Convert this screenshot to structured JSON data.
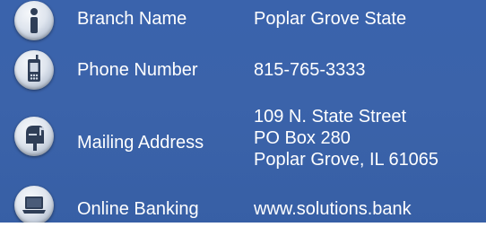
{
  "rows": {
    "branch": {
      "icon": "info-icon",
      "label": "Branch Name",
      "value": "Poplar Grove State"
    },
    "phone": {
      "icon": "phone-icon",
      "label": "Phone Number",
      "value": "815-765-3333"
    },
    "mailing": {
      "icon": "mailbox-icon",
      "label": "Mailing Address",
      "lines": [
        "109 N. State Street",
        "PO Box 280",
        "Poplar Grove, IL 61065"
      ]
    },
    "online": {
      "icon": "laptop-icon",
      "label": "Online Banking",
      "value": "www.solutions.bank"
    }
  },
  "colors": {
    "background": "#3a62aa",
    "text": "#ffffff",
    "icon_dark": "#2f3e57"
  }
}
